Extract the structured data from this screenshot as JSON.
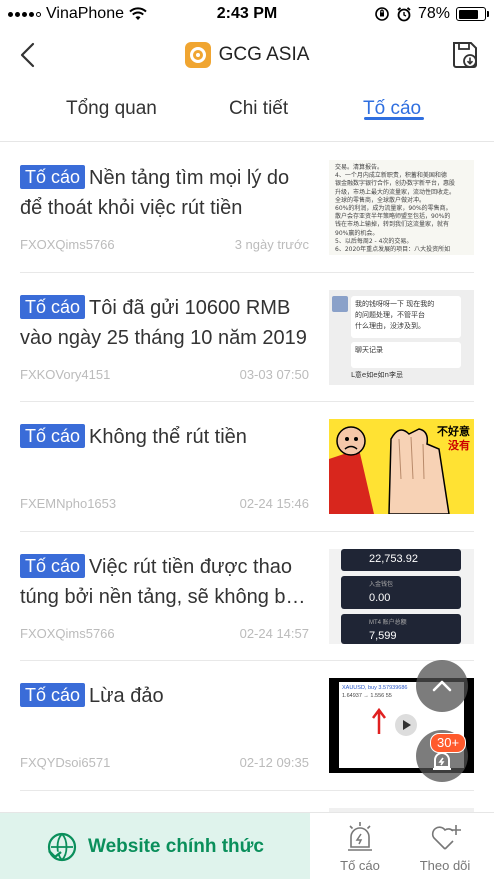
{
  "status_bar": {
    "carrier": "VinaPhone",
    "time": "2:43 PM",
    "battery": "78%",
    "battery_level": 0.78
  },
  "header": {
    "title": "GCG ASIA",
    "back_icon": "chevron-left-icon",
    "save_icon": "save-download-icon"
  },
  "tabs": [
    {
      "label": "Tổng quan",
      "active": false
    },
    {
      "label": "Chi tiết",
      "active": false
    },
    {
      "label": "Tố cáo",
      "active": true
    }
  ],
  "complaints": [
    {
      "badge": "Tố cáo",
      "title": "Nền tảng tìm mọi lý do để thoát khỏi việc rút tiền",
      "user": "FXOXQims5766",
      "time": "3 ngày trước",
      "thumb_lines": [
        "交易。清算报告。",
        "4、一个月内成立新职责，积蓄和美国和德",
        "银金融数字银行合作，创办数字新平台，惠股",
        "升级，市场上最大的流量家，流动性回收走。",
        "全球的零售商，全球散户做对冲。",
        "60%的利润，成为流量家，90%的零售商。",
        "散户会存亚资半年策略师盟至包括，90%的",
        "钱在市场上输掉，转到我们这流量家，就有",
        "90%赢的机会。",
        "5、以后每周2 - 4次的交易。",
        "6、2020年重点发展的项目：八大投资所如"
      ]
    },
    {
      "badge": "Tố cáo",
      "title": "Tôi đã gửi 10600 RMB vào ngày 25 tháng 10 năm 2019",
      "user": "FXKOVory4151",
      "time": "03-03 07:50",
      "thumb_lines": [
        "我的钱呀呀一下 现在我的",
        "的问题处理，不管平台",
        "什么理由，没涉及到。",
        "聊天记录",
        "L意e如e如n李忌"
      ]
    },
    {
      "badge": "Tố cáo",
      "title": "Không thể rút tiền",
      "user": "FXEMNpho1653",
      "time": "02-24 15:46",
      "thumb_lines": [
        "不好意",
        "没有"
      ]
    },
    {
      "badge": "Tố cáo",
      "title": "Việc rút tiền được thao túng bởi nền tảng, sẽ không bao giờ rút được",
      "user": "FXOXQims5766",
      "time": "02-24 14:57",
      "thumb_lines": [
        "22,753.92",
        "入金钱包",
        "0.00",
        "MT4 账户总额",
        "7,599"
      ]
    },
    {
      "badge": "Tố cáo",
      "title": "Lừa đảo",
      "user": "FXQYDsoi6571",
      "time": "02-12 09:35",
      "thumb_lines": [
        "XAUUSD, buy 3.57939686",
        "1.64937 → 1.556 55"
      ]
    }
  ],
  "floating": {
    "scroll_top_icon": "chevron-up-icon",
    "alarm_icon": "alarm-light-icon",
    "alarm_badge": "30+"
  },
  "bottom_bar": {
    "website_label": "Website chính thức",
    "website_icon": "handshake-icon",
    "report_label": "Tố cáo",
    "report_icon": "alarm-light-icon",
    "follow_label": "Theo dõi",
    "follow_icon": "heart-plus-icon"
  },
  "colors": {
    "accent": "#2f6fe0",
    "badge": "#3a6cd8",
    "website_green": "#0a8f5b",
    "website_bg": "#dff3ec",
    "alarm_badge": "#ff5a2c"
  }
}
